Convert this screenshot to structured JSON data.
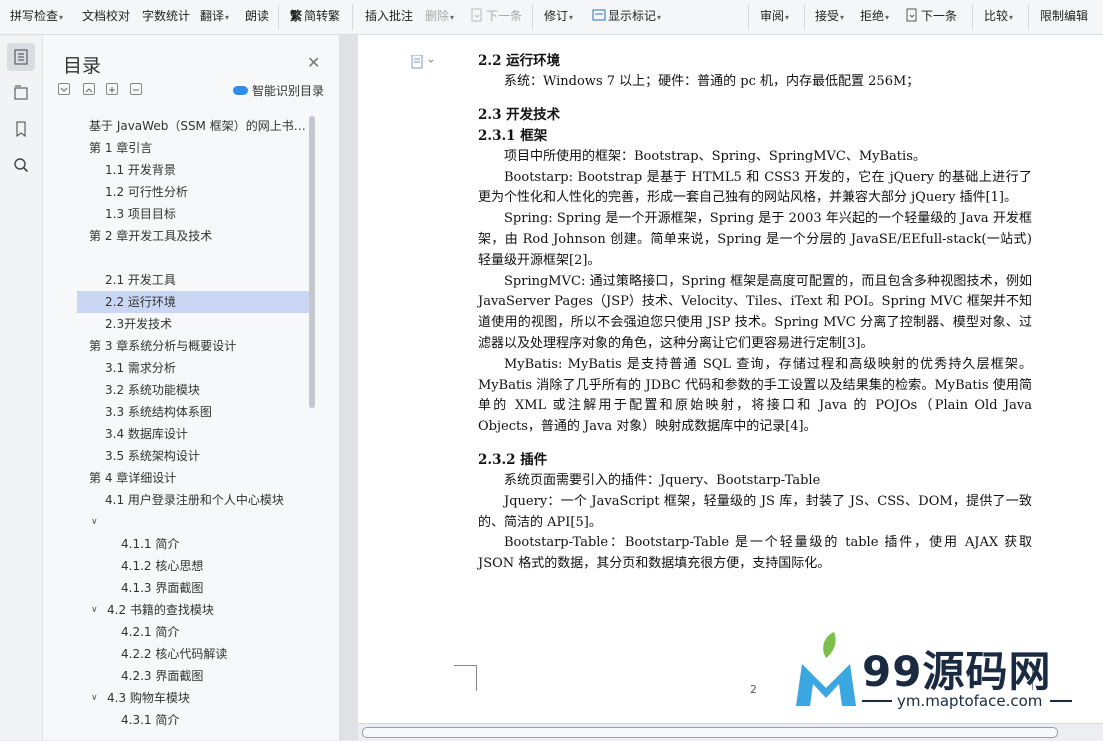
{
  "toolbar": {
    "items": [
      {
        "label": "拼写检查",
        "has_caret": true
      },
      {
        "label": "文档校对"
      },
      {
        "label": "字数统计"
      },
      {
        "label": "翻译",
        "has_caret": true
      },
      {
        "label": "朗读"
      },
      {
        "label": "简转繁"
      },
      {
        "label": "插入批注"
      },
      {
        "label": "删除",
        "has_caret": true,
        "disabled": true
      },
      {
        "label": "下一条",
        "disabled": true
      },
      {
        "label": "修订",
        "has_caret": true
      },
      {
        "label": "显示标记",
        "has_caret": true
      },
      {
        "label": "审阅",
        "has_caret": true
      },
      {
        "label": "接受",
        "has_caret": true
      },
      {
        "label": "拒绝",
        "has_caret": true
      },
      {
        "label": "下一条"
      },
      {
        "label": "比较",
        "has_caret": true
      },
      {
        "label": "限制编辑"
      }
    ]
  },
  "nav": {
    "title": "目录",
    "smart_toc": "智能识别目录",
    "items": [
      {
        "label": "基于 JavaWeb（SSM 框架）的网上书…",
        "level": 0
      },
      {
        "label": "第 1 章引言",
        "level": 0,
        "chevron": true
      },
      {
        "label": "1.1  开发背景",
        "level": 1
      },
      {
        "label": "1.2  可行性分析",
        "level": 1
      },
      {
        "label": "1.3  项目目标",
        "level": 1
      },
      {
        "label": "第 2 章开发工具及技术",
        "level": 0,
        "chevron": true
      },
      {
        "label": "",
        "level": 1
      },
      {
        "label": "2.1 开发工具",
        "level": 1
      },
      {
        "label": "2.2 运行环境",
        "level": 1,
        "selected": true
      },
      {
        "label": "2.3开发技术",
        "level": 1
      },
      {
        "label": "第 3 章系统分析与概要设计",
        "level": 0,
        "chevron": true
      },
      {
        "label": "3.1  需求分析",
        "level": 1
      },
      {
        "label": "3.2  系统功能模块",
        "level": 1
      },
      {
        "label": "3.3  系统结构体系图",
        "level": 1
      },
      {
        "label": "3.4  数据库设计",
        "level": 1
      },
      {
        "label": "3.5  系统架构设计",
        "level": 1
      },
      {
        "label": "第 4 章详细设计",
        "level": 0,
        "chevron": true
      },
      {
        "label": "4.1  用户登录注册和个人中心模块",
        "level": 1
      },
      {
        "label": "",
        "level": 1,
        "chevron": true
      },
      {
        "label": "4.1.1  简介",
        "level": 2
      },
      {
        "label": "4.1.2  核心思想",
        "level": 2
      },
      {
        "label": "4.1.3 界面截图",
        "level": 2
      },
      {
        "label": "4.2 书籍的查找模块",
        "level": 1,
        "chevron": true
      },
      {
        "label": "4.2.1  简介",
        "level": 2
      },
      {
        "label": "4.2.2  核心代码解读",
        "level": 2
      },
      {
        "label": "4.2.3 界面截图",
        "level": 2
      },
      {
        "label": "4.3  购物车模块",
        "level": 1,
        "chevron": true
      },
      {
        "label": "4.3.1  简介",
        "level": 2
      }
    ]
  },
  "doc": {
    "blocks": [
      {
        "type": "h",
        "text": "2.2 运行环境"
      },
      {
        "type": "p",
        "text": "系统：Windows 7 以上；硬件：普通的 pc 机，内存最低配置 256M；"
      },
      {
        "type": "gap"
      },
      {
        "type": "h",
        "text": "2.3 开发技术"
      },
      {
        "type": "h",
        "text": "2.3.1  框架"
      },
      {
        "type": "p",
        "text": "项目中所使用的框架：Bootstrap、Spring、SpringMVC、MyBatis。"
      },
      {
        "type": "p",
        "text": "Bootstarp: Bootstrap 是基于 HTML5 和 CSS3 开发的，它在 jQuery 的基础上进行了更为个性化和人性化的完善，形成一套自己独有的网站风格，并兼容大部分 jQuery 插件[1]。"
      },
      {
        "type": "p",
        "text": "Spring: Spring 是一个开源框架，Spring 是于 2003  年兴起的一个轻量级的 Java 开发框架，由 Rod Johnson 创建。简单来说，Spring 是一个分层的 JavaSE/EEfull-stack(一站式) 轻量级开源框架[2]。"
      },
      {
        "type": "p",
        "text": "SpringMVC: 通过策略接口，Spring 框架是高度可配置的，而且包含多种视图技术，例如 JavaServer Pages（JSP）技术、Velocity、Tiles、iText 和 POI。Spring MVC 框架并不知道使用的视图，所以不会强迫您只使用 JSP 技术。Spring MVC 分离了控制器、模型对象、过滤器以及处理程序对象的角色，这种分离让它们更容易进行定制[3]。"
      },
      {
        "type": "p",
        "text": "MyBatis: MyBatis 是支持普通 SQL 查询，存储过程和高级映射的优秀持久层框架。MyBatis 消除了几乎所有的 JDBC 代码和参数的手工设置以及结果集的检索。MyBatis 使用简单的 XML 或注解用于配置和原始映射，将接口和 Java 的 POJOs（Plain Old Java Objects，普通的 Java 对象）映射成数据库中的记录[4]。"
      },
      {
        "type": "gap"
      },
      {
        "type": "h",
        "text": "2.3.2  插件"
      },
      {
        "type": "p",
        "text": "系统页面需要引入的插件：Jquery、Bootstarp-Table"
      },
      {
        "type": "p",
        "text": "Jquery：一个 JavaScript 框架，轻量级的 JS 库，封装了 JS、CSS、DOM，提供了一致的、简洁的 API[5]。"
      },
      {
        "type": "p",
        "text": "Bootstarp-Table：Bootstarp-Table 是一个轻量级的 table 插件，使用 AJAX 获取 JSON 格式的数据，其分页和数据填充很方便，支持国际化。"
      }
    ],
    "page_number": "2"
  },
  "watermark": {
    "brand": "99源码网",
    "url": "ym.maptoface.com"
  },
  "colors": {
    "selection": "#c9d7f4",
    "accent": "#2f8ce8",
    "watermark_green": "#7cc04b",
    "watermark_blue": "#3ba7e0"
  }
}
